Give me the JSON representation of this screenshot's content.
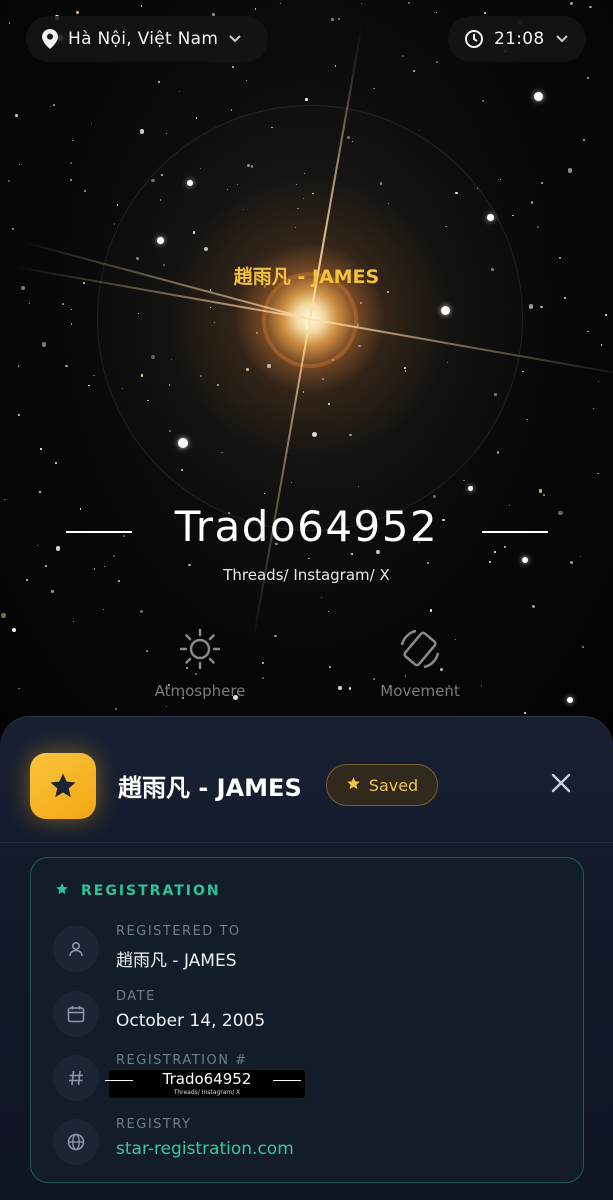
{
  "top_bar": {
    "location": "Hà Nội, Việt Nam",
    "time": "21:08"
  },
  "sky": {
    "star_label": "趙雨凡 - JAMES",
    "star_name": "Trado64952",
    "subline": "Threads/ Instagram/ X"
  },
  "modes": {
    "atmosphere": "Atmosphere",
    "movement": "Movement"
  },
  "panel": {
    "title": "趙雨凡 - JAMES",
    "saved_label": "Saved",
    "registration": {
      "header": "REGISTRATION",
      "items": [
        {
          "label": "REGISTERED TO",
          "value": "趙雨凡 - JAMES",
          "icon": "person-icon"
        },
        {
          "label": "DATE",
          "value": "October 14, 2005",
          "icon": "calendar-icon"
        },
        {
          "label": "REGISTRATION #",
          "value": "Trado64952",
          "sub": "Threads/ Instagram/ X",
          "icon": "hash-icon"
        },
        {
          "label": "REGISTRY",
          "value": "star-registration.com",
          "icon": "globe-icon"
        }
      ]
    }
  },
  "colors": {
    "accent_gold": "#f4c13a",
    "accent_green": "#2fc39a",
    "panel_bg": "#111827"
  }
}
